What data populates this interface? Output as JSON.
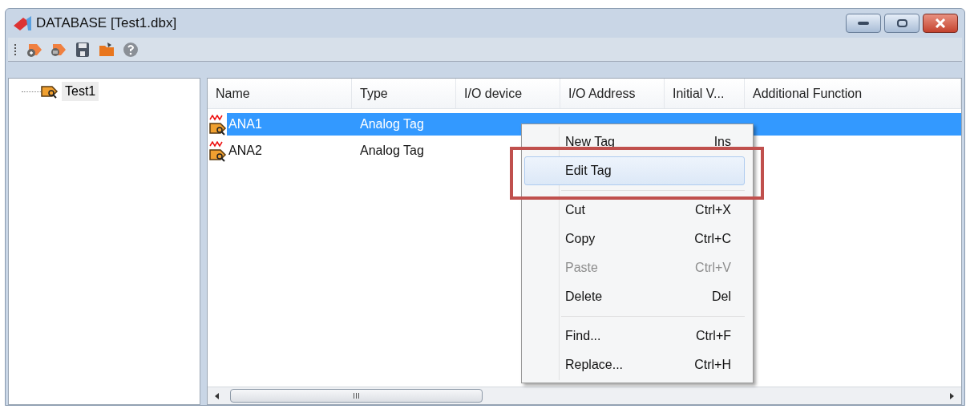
{
  "window": {
    "title": "DATABASE [Test1.dbx]"
  },
  "tree": {
    "items": [
      {
        "label": "Test1",
        "selected": true
      }
    ]
  },
  "table": {
    "columns": [
      "Name",
      "Type",
      "I/O device",
      "I/O Address",
      "Initial V...",
      "Additional Function"
    ],
    "rows": [
      {
        "cells": [
          "ANA1",
          "Analog Tag",
          "",
          "",
          "",
          ""
        ],
        "selected": true
      },
      {
        "cells": [
          "ANA2",
          "Analog Tag",
          "",
          "",
          "",
          ""
        ],
        "selected": false
      }
    ]
  },
  "context_menu": {
    "items": [
      {
        "kind": "item",
        "label": "New Tag",
        "shortcut": "Ins",
        "disabled": false,
        "highlighted": false
      },
      {
        "kind": "item",
        "label": "Edit Tag",
        "disabled": false,
        "highlighted": true
      },
      {
        "kind": "separator"
      },
      {
        "kind": "item",
        "label": "Cut",
        "shortcut": "Ctrl+X",
        "disabled": false,
        "highlighted": false
      },
      {
        "kind": "item",
        "label": "Copy",
        "shortcut": "Ctrl+C",
        "disabled": false,
        "highlighted": false
      },
      {
        "kind": "item",
        "label": "Paste",
        "shortcut": "Ctrl+V",
        "disabled": true,
        "highlighted": false
      },
      {
        "kind": "item",
        "label": "Delete",
        "shortcut": "Del",
        "disabled": false,
        "highlighted": false
      },
      {
        "kind": "separator"
      },
      {
        "kind": "item",
        "label": "Find...",
        "shortcut": "Ctrl+F",
        "disabled": false,
        "highlighted": false
      },
      {
        "kind": "item",
        "label": "Replace...",
        "shortcut": "Ctrl+H",
        "disabled": false,
        "highlighted": false
      }
    ]
  }
}
